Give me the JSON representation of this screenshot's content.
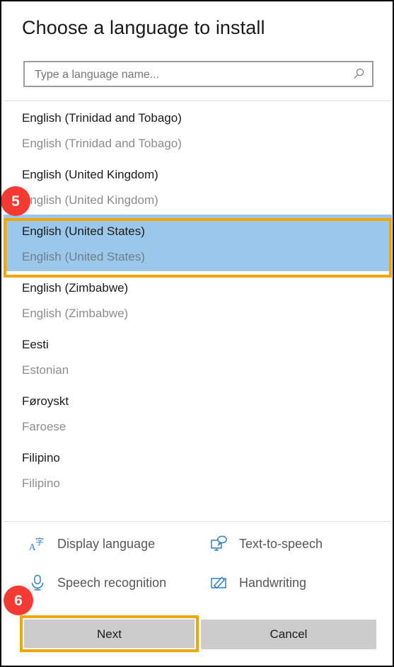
{
  "dialog": {
    "title": "Choose a language to install"
  },
  "search": {
    "placeholder": "Type a language name...",
    "value": "",
    "icon": "search-icon"
  },
  "language_list": [
    {
      "native": "English (Trinidad and Tobago)",
      "english": "English (Trinidad and Tobago)",
      "selected": false
    },
    {
      "native": "English (United Kingdom)",
      "english": "English (United Kingdom)",
      "selected": false
    },
    {
      "native": "English (United States)",
      "english": "English (United States)",
      "selected": true
    },
    {
      "native": "English (Zimbabwe)",
      "english": "English (Zimbabwe)",
      "selected": false
    },
    {
      "native": "Eesti",
      "english": "Estonian",
      "selected": false
    },
    {
      "native": "Føroyskt",
      "english": "Faroese",
      "selected": false
    },
    {
      "native": "Filipino",
      "english": "Filipino",
      "selected": false
    }
  ],
  "features": [
    {
      "label": "Display language",
      "icon": "translate-icon"
    },
    {
      "label": "Text-to-speech",
      "icon": "monitor-speech-bubble-icon"
    },
    {
      "label": "Speech recognition",
      "icon": "microphone-icon"
    },
    {
      "label": "Handwriting",
      "icon": "pen-writing-icon"
    }
  ],
  "footer": {
    "next_label": "Next",
    "cancel_label": "Cancel"
  },
  "annotations": [
    {
      "number": "5",
      "target": "selected-language-row"
    },
    {
      "number": "6",
      "target": "next-button"
    }
  ],
  "colors": {
    "selection_blue": "#9bc8ea",
    "annotation_orange": "#eea707",
    "badge_red": "#f33a33",
    "icon_blue": "#2e81c9",
    "button_gray": "#cccccc",
    "secondary_text": "#8c8c8c"
  }
}
